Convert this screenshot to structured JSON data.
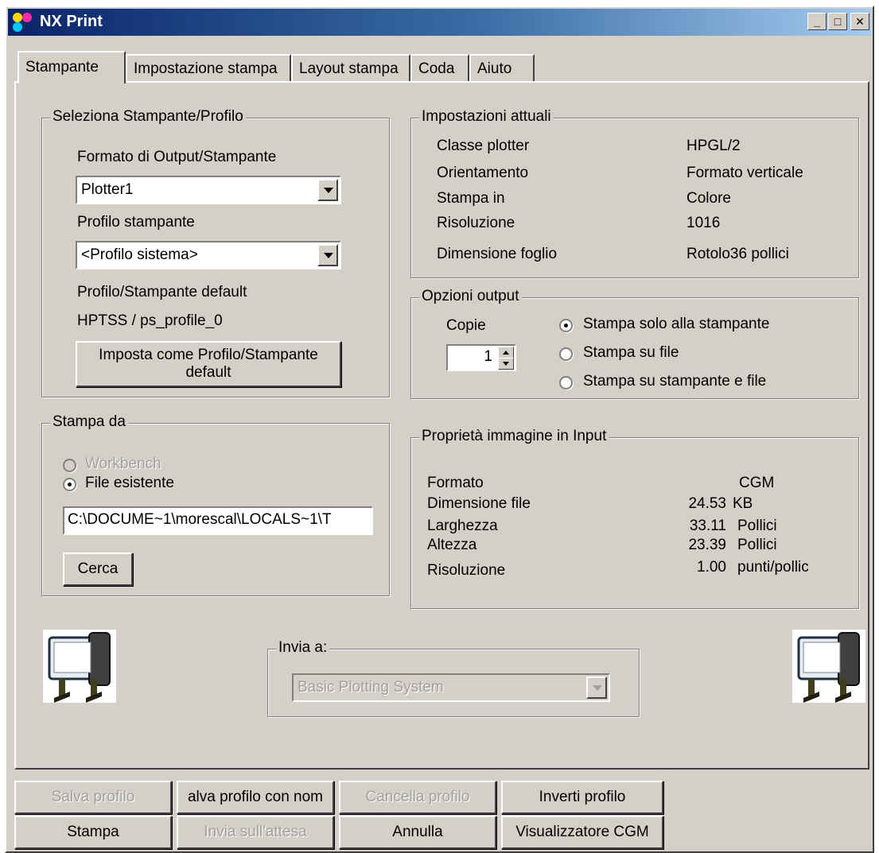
{
  "window": {
    "title": "NX Print"
  },
  "tabs": [
    "Stampante",
    "Impostazione stampa",
    "Layout stampa",
    "Coda",
    "Aiuto"
  ],
  "select_printer": {
    "legend": "Seleziona Stampante/Profilo",
    "output_format_label": "Formato di Output/Stampante",
    "output_format_value": "Plotter1",
    "printer_profile_label": "Profilo stampante",
    "printer_profile_value": "<Profilo sistema>",
    "default_label": "Profilo/Stampante default",
    "default_value": "HPTSS / ps_profile_0",
    "set_default_button": [
      "Imposta come Profilo/Stampante",
      "default"
    ]
  },
  "current_settings": {
    "legend": "Impostazioni attuali",
    "rows": [
      {
        "label": "Classe plotter",
        "value": "HPGL/2"
      },
      {
        "label": "Orientamento",
        "value": "Formato verticale"
      },
      {
        "label": "Stampa in",
        "value": "Colore"
      },
      {
        "label": "Risoluzione",
        "value": "1016"
      },
      {
        "label": "Dimensione foglio",
        "value": "Rotolo36 pollici"
      }
    ]
  },
  "output_options": {
    "legend": "Opzioni output",
    "copies_label": "Copie",
    "copies_value": "1",
    "radios": [
      {
        "label": "Stampa solo alla stampante",
        "checked": true
      },
      {
        "label": "Stampa su file",
        "checked": false
      },
      {
        "label": "Stampa su stampante e file",
        "checked": false
      }
    ]
  },
  "print_from": {
    "legend": "Stampa da",
    "radios": [
      {
        "label": "Workbench",
        "checked": false,
        "disabled": true
      },
      {
        "label": "File esistente",
        "checked": true,
        "disabled": false
      }
    ],
    "file_path": "C:\\DOCUME~1\\morescal\\LOCALS~1\\T",
    "browse_button": "Cerca"
  },
  "input_image": {
    "legend": "Proprietà immagine in Input",
    "rows": [
      {
        "label": "Formato",
        "value": "CGM",
        "unit": ""
      },
      {
        "label": "Dimensione file",
        "value": "24.53",
        "unit": "KB"
      },
      {
        "label": "Larghezza",
        "value": "33.11",
        "unit": "Pollici"
      },
      {
        "label": "Altezza",
        "value": "23.39",
        "unit": "Pollici"
      },
      {
        "label": "Risoluzione",
        "value": "1.00",
        "unit": "punti/pollic"
      }
    ]
  },
  "send_to": {
    "legend": "Invia a:",
    "value": "Basic Plotting System"
  },
  "bottom_buttons": {
    "save_profile": "Salva profilo",
    "save_profile_as": "alva profilo con nom",
    "delete_profile": "Cancella profilo",
    "revert_profile": "Inverti profilo",
    "print": "Stampa",
    "send_hold": "Invia sull'attesa",
    "cancel": "Annulla",
    "cgm_viewer": "Visualizzatore CGM"
  },
  "colors": {
    "face": "#d4d0c8",
    "title_start": "#0a246a",
    "title_end": "#a6caf0",
    "disabled_text": "#a0a0a0"
  },
  "icons": [
    "app-icon",
    "minimize-icon",
    "maximize-icon",
    "close-icon",
    "plotter-icon"
  ]
}
